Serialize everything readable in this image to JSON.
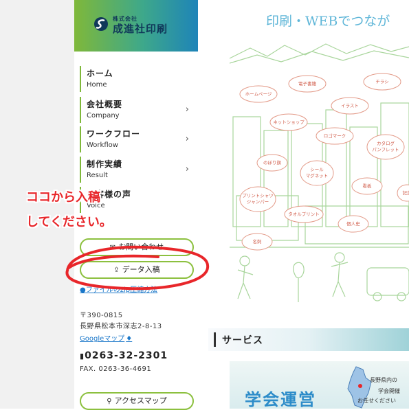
{
  "logo": {
    "company_small": "株式会社",
    "company_name": "成進社印刷"
  },
  "nav": [
    {
      "jp": "ホーム",
      "en": "Home",
      "chevron": ""
    },
    {
      "jp": "会社概要",
      "en": "Company",
      "chevron": "›"
    },
    {
      "jp": "ワークフロー",
      "en": "Workflow",
      "chevron": "›"
    },
    {
      "jp": "制作実績",
      "en": "Result",
      "chevron": "›"
    },
    {
      "jp": "お客様の声",
      "en": "Voice",
      "chevron": ""
    }
  ],
  "buttons": {
    "contact": "お問い合わせ",
    "upload": "データ入稿",
    "upload_icon": "⇪",
    "zip_link": "ファイルのzip圧縮方法"
  },
  "address": {
    "postal": "〒390-0815",
    "street": "長野県松本市深志2-8-13",
    "map_link": "Googleマップ",
    "tel": "0263-32-2301",
    "fax": "FAX. 0263-36-4691"
  },
  "access_button": "アクセスマップ",
  "hero": {
    "title": "印刷・WEBでつなが",
    "bubbles": [
      "ホームページ",
      "電子書籍",
      "チラシ",
      "イラスト",
      "ネットショップ",
      "ロゴマーク",
      "カタログ",
      "パンフレット",
      "のぼり旗",
      "シール",
      "マグネット",
      "看板",
      "記念",
      "プリントシャツ",
      "ジャンパー",
      "タオルプリント",
      "個人史",
      "名刺"
    ]
  },
  "services": {
    "heading": "サービス",
    "banner_title": "学会運営",
    "banner_line1": "長野県内の",
    "banner_line2": "学会開催",
    "banner_line3": "お任せください"
  },
  "annotation": {
    "line1": "ココから入稿",
    "line2": "してください。"
  },
  "colors": {
    "brand_green": "#8cc03f",
    "brand_blue": "#1e84b8",
    "link": "#1a77c9",
    "annotation_red": "#e8262a",
    "hero_text": "#5fb6d8"
  }
}
